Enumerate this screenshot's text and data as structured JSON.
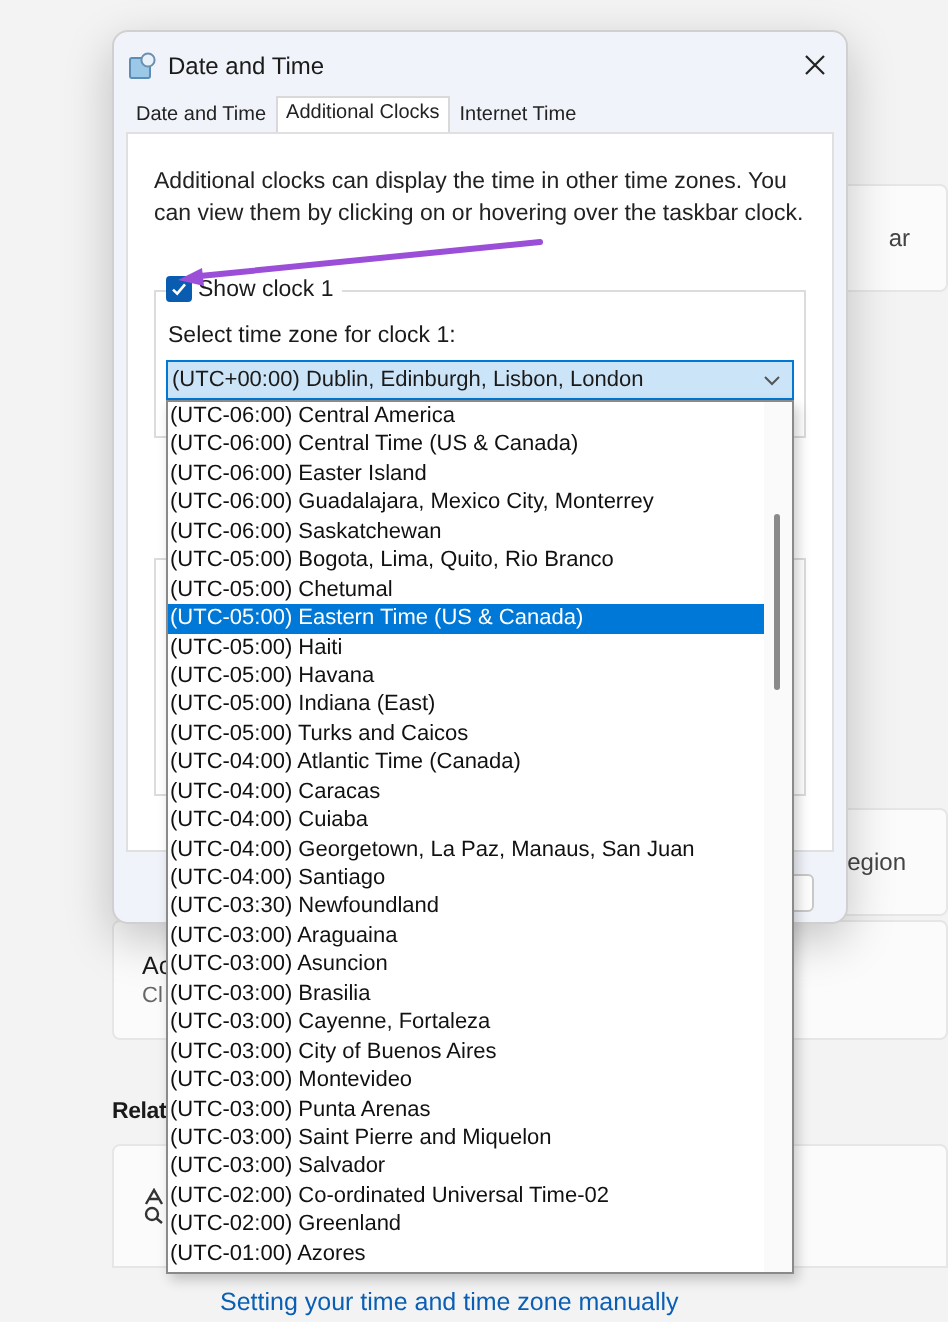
{
  "window": {
    "title": "Date and Time"
  },
  "tabs": [
    {
      "label": "Date and Time",
      "selected": false
    },
    {
      "label": "Additional Clocks",
      "selected": true
    },
    {
      "label": "Internet Time",
      "selected": false
    }
  ],
  "description": "Additional clocks can display the time in other time zones. You can view them by clicking on or hovering over the taskbar clock.",
  "clock_1": {
    "show_label": "Show clock 1",
    "checked": true,
    "zone_label": "Select time zone for clock 1:",
    "zone_value": "(UTC+00:00) Dublin, Edinburgh, Lisbon, London"
  },
  "timezone_options": [
    {
      "label": "(UTC-06:00) Central America",
      "selected": false
    },
    {
      "label": "(UTC-06:00) Central Time (US & Canada)",
      "selected": false
    },
    {
      "label": "(UTC-06:00) Easter Island",
      "selected": false
    },
    {
      "label": "(UTC-06:00) Guadalajara, Mexico City, Monterrey",
      "selected": false
    },
    {
      "label": "(UTC-06:00) Saskatchewan",
      "selected": false
    },
    {
      "label": "(UTC-05:00) Bogota, Lima, Quito, Rio Branco",
      "selected": false
    },
    {
      "label": "(UTC-05:00) Chetumal",
      "selected": false
    },
    {
      "label": "(UTC-05:00) Eastern Time (US & Canada)",
      "selected": true
    },
    {
      "label": "(UTC-05:00) Haiti",
      "selected": false
    },
    {
      "label": "(UTC-05:00) Havana",
      "selected": false
    },
    {
      "label": "(UTC-05:00) Indiana (East)",
      "selected": false
    },
    {
      "label": "(UTC-05:00) Turks and Caicos",
      "selected": false
    },
    {
      "label": "(UTC-04:00) Atlantic Time (Canada)",
      "selected": false
    },
    {
      "label": "(UTC-04:00) Caracas",
      "selected": false
    },
    {
      "label": "(UTC-04:00) Cuiaba",
      "selected": false
    },
    {
      "label": "(UTC-04:00) Georgetown, La Paz, Manaus, San Juan",
      "selected": false
    },
    {
      "label": "(UTC-04:00) Santiago",
      "selected": false
    },
    {
      "label": "(UTC-03:30) Newfoundland",
      "selected": false
    },
    {
      "label": "(UTC-03:00) Araguaina",
      "selected": false
    },
    {
      "label": "(UTC-03:00) Asuncion",
      "selected": false
    },
    {
      "label": "(UTC-03:00) Brasilia",
      "selected": false
    },
    {
      "label": "(UTC-03:00) Cayenne, Fortaleza",
      "selected": false
    },
    {
      "label": "(UTC-03:00) City of Buenos Aires",
      "selected": false
    },
    {
      "label": "(UTC-03:00) Montevideo",
      "selected": false
    },
    {
      "label": "(UTC-03:00) Punta Arenas",
      "selected": false
    },
    {
      "label": "(UTC-03:00) Saint Pierre and Miquelon",
      "selected": false
    },
    {
      "label": "(UTC-03:00) Salvador",
      "selected": false
    },
    {
      "label": "(UTC-02:00) Co-ordinated Universal Time-02",
      "selected": false
    },
    {
      "label": "(UTC-02:00) Greenland",
      "selected": false
    },
    {
      "label": "(UTC-01:00) Azores",
      "selected": false
    }
  ],
  "background_page": {
    "row_1_text": "ar",
    "row_2_text": "egion",
    "card_title": "Ac",
    "card_subtitle": "Cl",
    "section_heading": "Relat",
    "link": "Setting your time and time zone manually"
  }
}
